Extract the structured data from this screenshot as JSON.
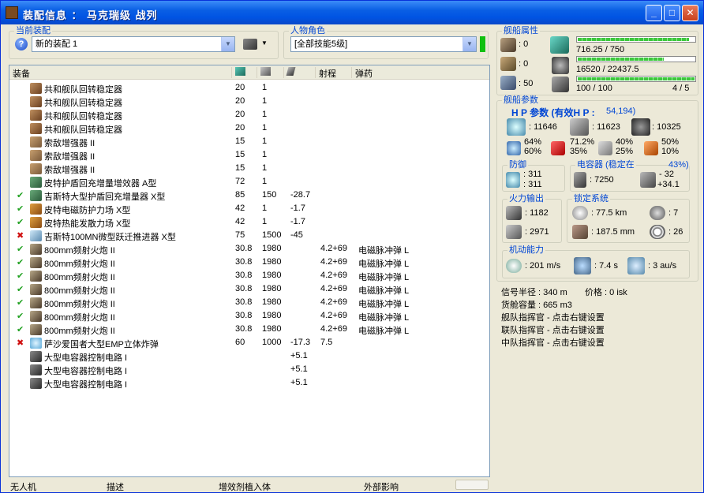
{
  "window": {
    "title": "装配信息 ： 马克瑞级 战列",
    "buttons": {
      "minimize": "_",
      "maximize": "□",
      "close": "✕"
    }
  },
  "fitting": {
    "legend": "当前装配",
    "name": "新的装配 1"
  },
  "character": {
    "legend": "人物角色",
    "value": "[全部技能5级]"
  },
  "columns": [
    "装备",
    "",
    "",
    "",
    "射程",
    "弹药"
  ],
  "modules": [
    {
      "state": "",
      "icon": "gyro",
      "name": "共和舰队回转稳定器",
      "c1": "20",
      "c2": "1",
      "c3": "",
      "range": "",
      "ammo": ""
    },
    {
      "state": "",
      "icon": "gyro",
      "name": "共和舰队回转稳定器",
      "c1": "20",
      "c2": "1",
      "c3": "",
      "range": "",
      "ammo": ""
    },
    {
      "state": "",
      "icon": "gyro",
      "name": "共和舰队回转稳定器",
      "c1": "20",
      "c2": "1",
      "c3": "",
      "range": "",
      "ammo": ""
    },
    {
      "state": "",
      "icon": "gyro",
      "name": "共和舰队回转稳定器",
      "c1": "20",
      "c2": "1",
      "c3": "",
      "range": "",
      "ammo": ""
    },
    {
      "state": "",
      "icon": "sens",
      "name": "索敌增强器 II",
      "c1": "15",
      "c2": "1",
      "c3": "",
      "range": "",
      "ammo": ""
    },
    {
      "state": "",
      "icon": "sens",
      "name": "索敌增强器 II",
      "c1": "15",
      "c2": "1",
      "c3": "",
      "range": "",
      "ammo": ""
    },
    {
      "state": "",
      "icon": "sens",
      "name": "索敌增强器 II",
      "c1": "15",
      "c2": "1",
      "c3": "",
      "range": "",
      "ammo": ""
    },
    {
      "state": "",
      "icon": "shld",
      "name": "皮特护盾回充增量增效器 A型",
      "c1": "72",
      "c2": "1",
      "c3": "",
      "range": "",
      "ammo": ""
    },
    {
      "state": "check",
      "icon": "shld",
      "name": "吉斯特大型护盾回充增量器 X型",
      "c1": "85",
      "c2": "150",
      "c3": "-28.7",
      "range": "",
      "ammo": ""
    },
    {
      "state": "check",
      "icon": "harm",
      "name": "皮特电磁防护力场 X型",
      "c1": "42",
      "c2": "1",
      "c3": "-1.7",
      "range": "",
      "ammo": ""
    },
    {
      "state": "check",
      "icon": "harm",
      "name": "皮特热能发散力场 X型",
      "c1": "42",
      "c2": "1",
      "c3": "-1.7",
      "range": "",
      "ammo": ""
    },
    {
      "state": "cross",
      "icon": "mwd",
      "name": "吉斯特100MN微型跃迁推进器 X型",
      "c1": "75",
      "c2": "1500",
      "c3": "-45",
      "range": "",
      "ammo": ""
    },
    {
      "state": "check",
      "icon": "gun",
      "name": "800mm频射火炮 II",
      "c1": "30.8",
      "c2": "1980",
      "c3": "",
      "range": "4.2+69",
      "ammo": "电磁脉冲弹 L"
    },
    {
      "state": "check",
      "icon": "gun",
      "name": "800mm频射火炮 II",
      "c1": "30.8",
      "c2": "1980",
      "c3": "",
      "range": "4.2+69",
      "ammo": "电磁脉冲弹 L"
    },
    {
      "state": "check",
      "icon": "gun",
      "name": "800mm频射火炮 II",
      "c1": "30.8",
      "c2": "1980",
      "c3": "",
      "range": "4.2+69",
      "ammo": "电磁脉冲弹 L"
    },
    {
      "state": "check",
      "icon": "gun",
      "name": "800mm频射火炮 II",
      "c1": "30.8",
      "c2": "1980",
      "c3": "",
      "range": "4.2+69",
      "ammo": "电磁脉冲弹 L"
    },
    {
      "state": "check",
      "icon": "gun",
      "name": "800mm频射火炮 II",
      "c1": "30.8",
      "c2": "1980",
      "c3": "",
      "range": "4.2+69",
      "ammo": "电磁脉冲弹 L"
    },
    {
      "state": "check",
      "icon": "gun",
      "name": "800mm频射火炮 II",
      "c1": "30.8",
      "c2": "1980",
      "c3": "",
      "range": "4.2+69",
      "ammo": "电磁脉冲弹 L"
    },
    {
      "state": "check",
      "icon": "gun",
      "name": "800mm频射火炮 II",
      "c1": "30.8",
      "c2": "1980",
      "c3": "",
      "range": "4.2+69",
      "ammo": "电磁脉冲弹 L"
    },
    {
      "state": "cross",
      "icon": "smart",
      "name": "萨沙爱国者大型EMP立体炸弹",
      "c1": "60",
      "c2": "1000",
      "c3": "-17.3",
      "range": "7.5",
      "ammo": ""
    },
    {
      "state": "",
      "icon": "cpr",
      "name": "大型电容器控制电路 I",
      "c1": "",
      "c2": "",
      "c3": "+5.1",
      "range": "",
      "ammo": ""
    },
    {
      "state": "",
      "icon": "cpr",
      "name": "大型电容器控制电路 I",
      "c1": "",
      "c2": "",
      "c3": "+5.1",
      "range": "",
      "ammo": ""
    },
    {
      "state": "",
      "icon": "cpr",
      "name": "大型电容器控制电路 I",
      "c1": "",
      "c2": "",
      "c3": "+5.1",
      "range": "",
      "ammo": ""
    }
  ],
  "bottom_tabs": [
    "无人机",
    "描述",
    "增效剂植入体",
    "外部影响"
  ],
  "ship": {
    "legend": "舰船属性",
    "slots": {
      "high": ": 0",
      "mid": ": 0",
      "low": ": 50"
    },
    "cpu": "716.25 / 750",
    "cpu_fill": 0.955,
    "power": "16520 / 22437.5",
    "power_fill": 0.736,
    "calib": "100 / 100",
    "calib_fill": 1.0,
    "rigs": "4 / 5"
  },
  "params": {
    "legend": "舰船参数",
    "hp_label": "H P 参数 (有效H P :",
    "ehp": "54,194)",
    "shield_hp": ": 11646",
    "armor_hp": ": 11623",
    "struct_hp": ": 10325",
    "res1a": "64%",
    "res1b": "60%",
    "res2a": "71.2%",
    "res2b": "35%",
    "res3a": "40%",
    "res3b": "25%",
    "res4a": "50%",
    "res4b": "10%"
  },
  "defense": {
    "legend": "防御",
    "a": ": 311",
    "b": ": 311"
  },
  "capacitor": {
    "legend": "电容器 (稳定在",
    "pct": "43%)",
    "cap": ": 7250",
    "d1": "- 32",
    "d2": "+34.1"
  },
  "firepower": {
    "legend": "火力输出",
    "dps": ": 1182",
    "volley": ": 2971"
  },
  "targeting": {
    "legend": "锁定系统",
    "range": ": 77.5 km",
    "targets": ": 7",
    "res": ": 187.5 mm",
    "sensor": ": 26"
  },
  "mobility": {
    "legend": "机动能力",
    "speed": ": 201 m/s",
    "align": ": 7.4 s",
    "warp": ": 3 au/s"
  },
  "info": {
    "sig": "信号半径 : 340 m",
    "price": "价格 : 0 isk",
    "cargo": "货舱容量 : 665 m3",
    "fleet": "舰队指挥官 - 点击右键设置",
    "wing": "联队指挥官 - 点击右键设置",
    "squad": "中队指挥官 - 点击右键设置"
  }
}
